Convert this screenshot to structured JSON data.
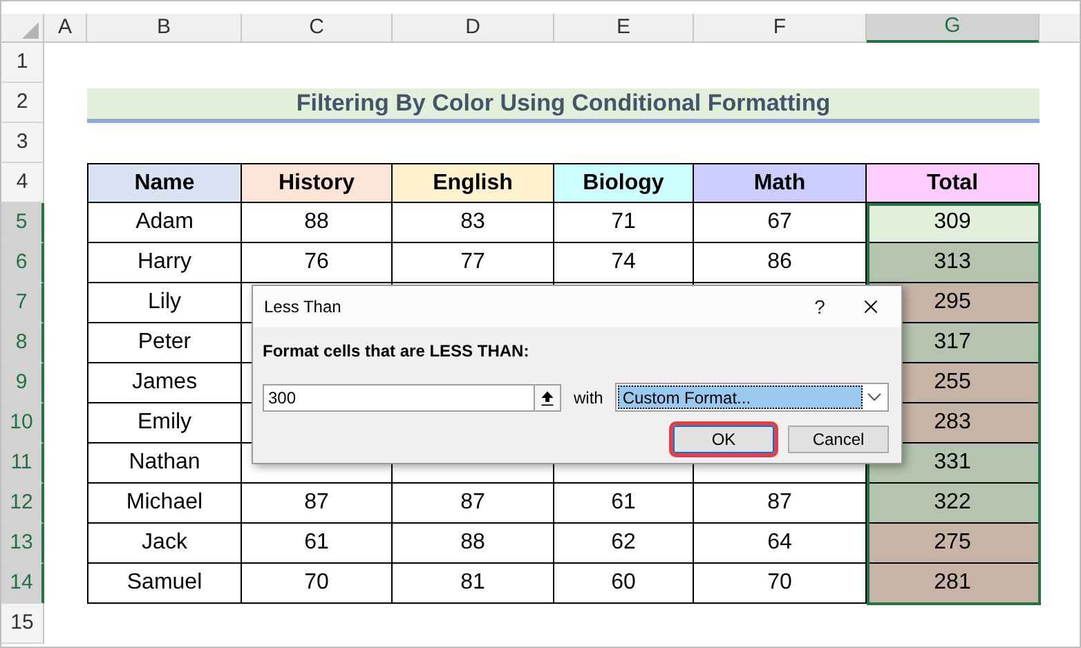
{
  "column_headers": [
    {
      "label": "A",
      "selected": false
    },
    {
      "label": "B",
      "selected": false
    },
    {
      "label": "C",
      "selected": false
    },
    {
      "label": "D",
      "selected": false
    },
    {
      "label": "E",
      "selected": false
    },
    {
      "label": "F",
      "selected": false
    },
    {
      "label": "G",
      "selected": true
    }
  ],
  "row_headers": [
    {
      "label": "1",
      "selected": false
    },
    {
      "label": "2",
      "selected": false
    },
    {
      "label": "3",
      "selected": false
    },
    {
      "label": "4",
      "selected": false
    },
    {
      "label": "5",
      "selected": true
    },
    {
      "label": "6",
      "selected": true
    },
    {
      "label": "7",
      "selected": true
    },
    {
      "label": "8",
      "selected": true
    },
    {
      "label": "9",
      "selected": true
    },
    {
      "label": "10",
      "selected": true
    },
    {
      "label": "11",
      "selected": true
    },
    {
      "label": "12",
      "selected": true
    },
    {
      "label": "13",
      "selected": true
    },
    {
      "label": "14",
      "selected": true
    },
    {
      "label": "15",
      "selected": false
    }
  ],
  "title": "Filtering By Color Using Conditional Formatting",
  "table": {
    "columns": [
      {
        "label": "Name",
        "color": "#dae3f3"
      },
      {
        "label": "History",
        "color": "#fce4d6"
      },
      {
        "label": "English",
        "color": "#fff2cc"
      },
      {
        "label": "Biology",
        "color": "#ccffff"
      },
      {
        "label": "Math",
        "color": "#ccccff"
      },
      {
        "label": "Total",
        "color": "#ffccff"
      }
    ],
    "rows": [
      {
        "name": "Adam",
        "scores": [
          "88",
          "83",
          "71",
          "67"
        ],
        "total": "309",
        "color": "#e2efda"
      },
      {
        "name": "Harry",
        "scores": [
          "76",
          "77",
          "74",
          "86"
        ],
        "total": "313",
        "color": "#b4c4ae"
      },
      {
        "name": "Lily",
        "total": "295",
        "color": "#c8b4a6"
      },
      {
        "name": "Peter",
        "total": "317",
        "color": "#b4c4ae"
      },
      {
        "name": "James",
        "total": "255",
        "color": "#c8b4a6"
      },
      {
        "name": "Emily",
        "total": "283",
        "color": "#c8b4a6"
      },
      {
        "name": "Nathan",
        "total": "331",
        "color": "#b4c4ae"
      },
      {
        "name": "Michael",
        "scores": [
          "87",
          "87",
          "61",
          "87"
        ],
        "total": "322",
        "color": "#b4c4ae"
      },
      {
        "name": "Jack",
        "scores": [
          "61",
          "88",
          "62",
          "64"
        ],
        "total": "275",
        "color": "#c8b4a6"
      },
      {
        "name": "Samuel",
        "scores": [
          "70",
          "81",
          "60",
          "70"
        ],
        "total": "281",
        "color": "#c8b4a6"
      }
    ]
  },
  "dialog": {
    "title": "Less Than",
    "help": "?",
    "prompt": "Format cells that are LESS THAN:",
    "value": "300",
    "with_label": "with",
    "format": "Custom Format...",
    "buttons": [
      {
        "label": "OK",
        "highlighted": true
      },
      {
        "label": "Cancel",
        "highlighted": false
      }
    ]
  }
}
